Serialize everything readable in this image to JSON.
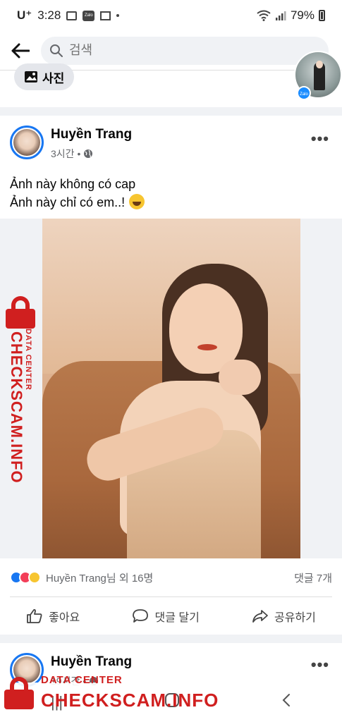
{
  "status_bar": {
    "carrier": "U⁺",
    "time": "3:28",
    "battery": "79%"
  },
  "search": {
    "placeholder": "검색"
  },
  "top_chip": {
    "label": "사진"
  },
  "post": {
    "author": "Huyền Trang",
    "time": "3시간",
    "text_line1": "Ảnh này không có cap",
    "text_line2": "Ảnh này chỉ có em..!",
    "reactions_text": "Huyền Trang님 외 16명",
    "comments_count": "댓글 7개",
    "actions": {
      "like": "좋아요",
      "comment": "댓글 달기",
      "share": "공유하기"
    }
  },
  "post2": {
    "author": "Huyền Trang",
    "time": "19시간"
  },
  "watermark": {
    "data_center": "DATA CENTER",
    "brand": "CHECKSCAM.INFO"
  },
  "icons": {
    "back": "arrow-left-icon",
    "search": "search-icon",
    "photo": "photo-icon",
    "globe": "globe-icon",
    "more": "more-icon",
    "like": "thumbs-up-icon",
    "comment": "comment-icon",
    "share": "share-icon"
  },
  "colors": {
    "facebook_blue": "#1877f2",
    "watermark_red": "#d01f1f",
    "love_red": "#f33e58",
    "haha_yellow": "#f7c530"
  }
}
